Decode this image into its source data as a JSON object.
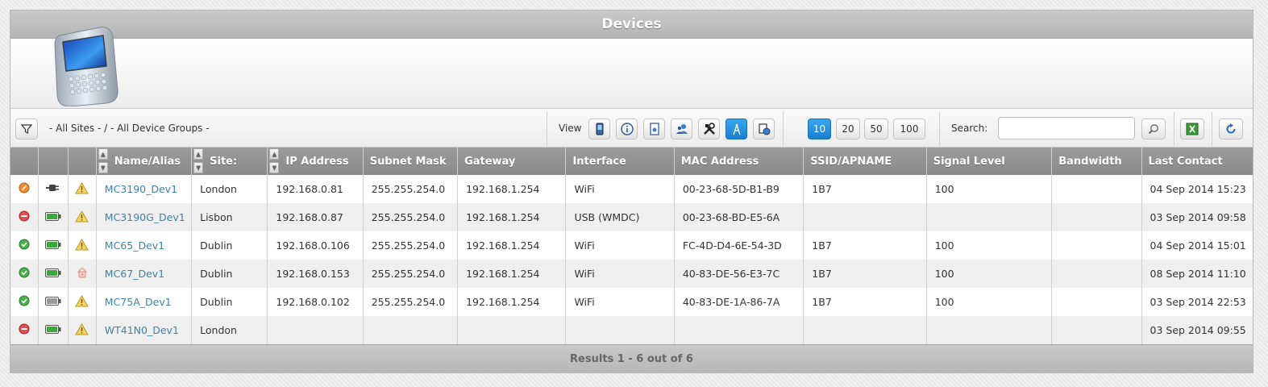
{
  "title": "Devices",
  "toolbar": {
    "filter_text": "- All Sites - / - All Device Groups -",
    "view_label": "View",
    "page_sizes": [
      "10",
      "20",
      "50",
      "100"
    ],
    "active_page_size": "10",
    "search_label": "Search:",
    "search_value": ""
  },
  "view_icons": [
    "device-view-icon",
    "info-view-icon",
    "document-view-icon",
    "users-view-icon",
    "tools-view-icon",
    "antenna-view-icon",
    "network-view-icon"
  ],
  "columns": [
    "Name/Alias",
    "Site:",
    "IP Address",
    "Subnet Mask",
    "Gateway",
    "Interface",
    "MAC Address",
    "SSID/APNAME",
    "Signal Level",
    "Bandwidth",
    "Last Contact"
  ],
  "rows": [
    {
      "status": "orange",
      "power": "plug",
      "alert": "warning",
      "name": "MC3190_Dev1",
      "site": "London",
      "ip": "192.168.0.81",
      "mask": "255.255.254.0",
      "gateway": "192.168.1.254",
      "iface": "WiFi",
      "mac": "00-23-68-5D-B1-B9",
      "ssid": "1B7",
      "signal": "100",
      "bandwidth": "",
      "last": "04 Sep 2014 15:23"
    },
    {
      "status": "red",
      "power": "battery",
      "alert": "warning",
      "name": "MC3190G_Dev1",
      "site": "Lisbon",
      "ip": "192.168.0.87",
      "mask": "255.255.254.0",
      "gateway": "192.168.1.254",
      "iface": "USB (WMDC)",
      "mac": "00-23-68-BD-E5-6A",
      "ssid": "",
      "signal": "",
      "bandwidth": "",
      "last": "03 Sep 2014 09:58"
    },
    {
      "status": "green",
      "power": "battery",
      "alert": "warning",
      "name": "MC65_Dev1",
      "site": "Dublin",
      "ip": "192.168.0.106",
      "mask": "255.255.254.0",
      "gateway": "192.168.1.254",
      "iface": "WiFi",
      "mac": "FC-4D-D4-6E-54-3D",
      "ssid": "1B7",
      "signal": "100",
      "bandwidth": "",
      "last": "04 Sep 2014 15:01"
    },
    {
      "status": "green",
      "power": "battery",
      "alert": "lock",
      "name": "MC67_Dev1",
      "site": "Dublin",
      "ip": "192.168.0.153",
      "mask": "255.255.254.0",
      "gateway": "192.168.1.254",
      "iface": "WiFi",
      "mac": "40-83-DE-56-E3-7C",
      "ssid": "1B7",
      "signal": "100",
      "bandwidth": "",
      "last": "08 Sep 2014 11:10"
    },
    {
      "status": "green",
      "power": "battery-grey",
      "alert": "warning",
      "name": "MC75A_Dev1",
      "site": "Dublin",
      "ip": "192.168.0.102",
      "mask": "255.255.254.0",
      "gateway": "192.168.1.254",
      "iface": "WiFi",
      "mac": "40-83-DE-1A-86-7A",
      "ssid": "1B7",
      "signal": "100",
      "bandwidth": "",
      "last": "03 Sep 2014 22:53"
    },
    {
      "status": "red",
      "power": "battery",
      "alert": "warning",
      "name": "WT41N0_Dev1",
      "site": "London",
      "ip": "",
      "mask": "",
      "gateway": "",
      "iface": "",
      "mac": "",
      "ssid": "",
      "signal": "",
      "bandwidth": "",
      "last": "03 Sep 2014 09:55"
    }
  ],
  "footer": "Results 1 - 6 out of 6",
  "colors": {
    "active_blue": "#1f8ad8",
    "link": "#3d83a8",
    "header_grey": "#939393"
  }
}
